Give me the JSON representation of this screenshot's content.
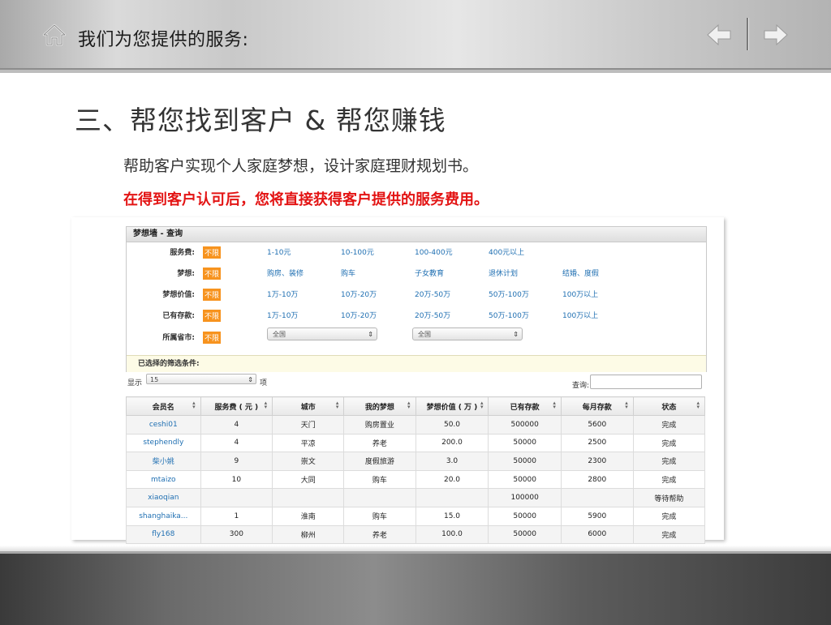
{
  "header": {
    "title": "我们为您提供的服务:",
    "icons": {
      "home": "home-icon",
      "back": "arrow-left-icon",
      "forward": "arrow-right-icon"
    }
  },
  "slide": {
    "heading": "三、帮您找到客户 & 帮您赚钱",
    "line1": "帮助客户实现个人家庭梦想，设计家庭理财规划书。",
    "line2": "在得到客户认可后，您将直接获得客户提供的服务费用。"
  },
  "colors": {
    "accent_red": "#e31414",
    "badge_orange": "#f7931e",
    "link_blue": "#1f6fb2"
  },
  "filter": {
    "title": "梦想墙 - 查询",
    "rows": [
      {
        "label": "服务费:",
        "badge": "不限",
        "options": [
          "1-10元",
          "10-100元",
          "100-400元",
          "400元以上"
        ]
      },
      {
        "label": "梦想:",
        "badge": "不限",
        "options": [
          "购房、装修",
          "购车",
          "子女教育",
          "退休计划",
          "结婚、度假"
        ]
      },
      {
        "label": "梦想价值:",
        "badge": "不限",
        "options": [
          "1万-10万",
          "10万-20万",
          "20万-50万",
          "50万-100万",
          "100万以上"
        ]
      },
      {
        "label": "已有存款:",
        "badge": "不限",
        "options": [
          "1万-10万",
          "10万-20万",
          "20万-50万",
          "50万-100万",
          "100万以上"
        ]
      },
      {
        "label": "所属省市:",
        "badge": "不限",
        "selects": [
          "全国",
          "全国"
        ]
      }
    ],
    "chosen_label": "已选择的筛选条件:"
  },
  "list_controls": {
    "show_label": "显示",
    "page_size": "15",
    "unit": "项",
    "search_label": "查询:"
  },
  "table": {
    "headers": [
      "会员名",
      "服务费 ( 元 )",
      "城市",
      "我的梦想",
      "梦想价值 ( 万 )",
      "已有存款",
      "每月存款",
      "状态"
    ],
    "rows": [
      [
        "ceshi01",
        "4",
        "天门",
        "购房置业",
        "50.0",
        "500000",
        "5600",
        "完成"
      ],
      [
        "stephendly",
        "4",
        "平凉",
        "养老",
        "200.0",
        "50000",
        "2500",
        "完成"
      ],
      [
        "柴小姚",
        "9",
        "崇文",
        "度假旅游",
        "3.0",
        "50000",
        "2300",
        "完成"
      ],
      [
        "mtaizo",
        "10",
        "大同",
        "购车",
        "20.0",
        "50000",
        "2800",
        "完成"
      ],
      [
        "xiaoqian",
        "",
        "",
        "",
        "",
        "100000",
        "",
        "等待帮助"
      ],
      [
        "shanghaika...",
        "1",
        "淮南",
        "购车",
        "15.0",
        "50000",
        "5900",
        "完成"
      ],
      [
        "fly168",
        "300",
        "柳州",
        "养老",
        "100.0",
        "50000",
        "6000",
        "完成"
      ]
    ]
  }
}
